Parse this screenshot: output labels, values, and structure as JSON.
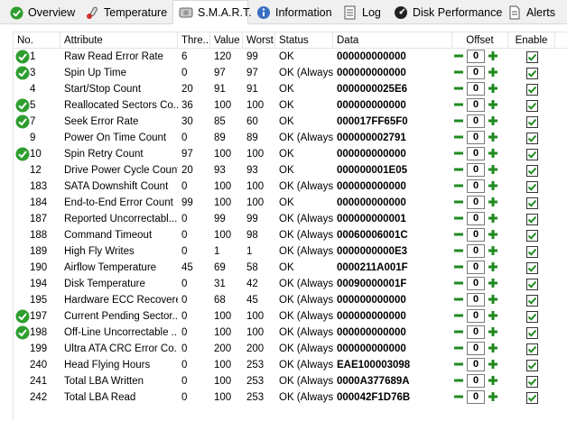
{
  "tabs": [
    {
      "label": "Overview",
      "icon": "check-circle-icon"
    },
    {
      "label": "Temperature",
      "icon": "thermometer-icon"
    },
    {
      "label": "S.M.A.R.T.",
      "icon": "disk-icon"
    },
    {
      "label": "Information",
      "icon": "info-icon"
    },
    {
      "label": "Log",
      "icon": "notepad-icon"
    },
    {
      "label": "Disk Performance",
      "icon": "gauge-icon"
    },
    {
      "label": "Alerts",
      "icon": "document-icon"
    }
  ],
  "active_tab": "S.M.A.R.T.",
  "columns": [
    "No.",
    "Attribute",
    "Thre...",
    "Value",
    "Worst",
    "Status",
    "Data",
    "Offset",
    "Enable"
  ],
  "colors": {
    "ok_green": "#2e9e2e",
    "button_green": "#1f8a1f"
  },
  "rows": [
    {
      "no": "1",
      "attr": "Raw Read Error Rate",
      "thr": "6",
      "val": "120",
      "worst": "99",
      "status": "OK",
      "data": "000000000000",
      "offset": "0",
      "ok": true
    },
    {
      "no": "3",
      "attr": "Spin Up Time",
      "thr": "0",
      "val": "97",
      "worst": "97",
      "status": "OK (Always...",
      "data": "000000000000",
      "offset": "0",
      "ok": true
    },
    {
      "no": "4",
      "attr": "Start/Stop Count",
      "thr": "20",
      "val": "91",
      "worst": "91",
      "status": "OK",
      "data": "0000000025E6",
      "offset": "0",
      "ok": false
    },
    {
      "no": "5",
      "attr": "Reallocated Sectors Co...",
      "thr": "36",
      "val": "100",
      "worst": "100",
      "status": "OK",
      "data": "000000000000",
      "offset": "0",
      "ok": true
    },
    {
      "no": "7",
      "attr": "Seek Error Rate",
      "thr": "30",
      "val": "85",
      "worst": "60",
      "status": "OK",
      "data": "000017FF65F0",
      "offset": "0",
      "ok": true
    },
    {
      "no": "9",
      "attr": "Power On Time Count",
      "thr": "0",
      "val": "89",
      "worst": "89",
      "status": "OK (Always...",
      "data": "000000002791",
      "offset": "0",
      "ok": false
    },
    {
      "no": "10",
      "attr": "Spin Retry Count",
      "thr": "97",
      "val": "100",
      "worst": "100",
      "status": "OK",
      "data": "000000000000",
      "offset": "0",
      "ok": true
    },
    {
      "no": "12",
      "attr": "Drive Power Cycle Count",
      "thr": "20",
      "val": "93",
      "worst": "93",
      "status": "OK",
      "data": "000000001E05",
      "offset": "0",
      "ok": false
    },
    {
      "no": "183",
      "attr": "SATA Downshift Count",
      "thr": "0",
      "val": "100",
      "worst": "100",
      "status": "OK (Always...",
      "data": "000000000000",
      "offset": "0",
      "ok": false
    },
    {
      "no": "184",
      "attr": "End-to-End Error Count",
      "thr": "99",
      "val": "100",
      "worst": "100",
      "status": "OK",
      "data": "000000000000",
      "offset": "0",
      "ok": false
    },
    {
      "no": "187",
      "attr": "Reported Uncorrectabl...",
      "thr": "0",
      "val": "99",
      "worst": "99",
      "status": "OK (Always...",
      "data": "000000000001",
      "offset": "0",
      "ok": false
    },
    {
      "no": "188",
      "attr": "Command Timeout",
      "thr": "0",
      "val": "100",
      "worst": "98",
      "status": "OK (Always...",
      "data": "00060006001C",
      "offset": "0",
      "ok": false
    },
    {
      "no": "189",
      "attr": "High Fly Writes",
      "thr": "0",
      "val": "1",
      "worst": "1",
      "status": "OK (Always...",
      "data": "0000000000E3",
      "offset": "0",
      "ok": false
    },
    {
      "no": "190",
      "attr": "Airflow Temperature",
      "thr": "45",
      "val": "69",
      "worst": "58",
      "status": "OK",
      "data": "0000211A001F",
      "offset": "0",
      "ok": false
    },
    {
      "no": "194",
      "attr": "Disk Temperature",
      "thr": "0",
      "val": "31",
      "worst": "42",
      "status": "OK (Always...",
      "data": "00090000001F",
      "offset": "0",
      "ok": false
    },
    {
      "no": "195",
      "attr": "Hardware ECC Recovered",
      "thr": "0",
      "val": "68",
      "worst": "45",
      "status": "OK (Always...",
      "data": "000000000000",
      "offset": "0",
      "ok": false
    },
    {
      "no": "197",
      "attr": "Current Pending Sector...",
      "thr": "0",
      "val": "100",
      "worst": "100",
      "status": "OK (Always...",
      "data": "000000000000",
      "offset": "0",
      "ok": true
    },
    {
      "no": "198",
      "attr": "Off-Line Uncorrectable ...",
      "thr": "0",
      "val": "100",
      "worst": "100",
      "status": "OK (Always...",
      "data": "000000000000",
      "offset": "0",
      "ok": true
    },
    {
      "no": "199",
      "attr": "Ultra ATA CRC Error Co...",
      "thr": "0",
      "val": "200",
      "worst": "200",
      "status": "OK (Always...",
      "data": "000000000000",
      "offset": "0",
      "ok": false
    },
    {
      "no": "240",
      "attr": "Head Flying Hours",
      "thr": "0",
      "val": "100",
      "worst": "253",
      "status": "OK (Always...",
      "data": "EAE100003098",
      "offset": "0",
      "ok": false
    },
    {
      "no": "241",
      "attr": "Total LBA Written",
      "thr": "0",
      "val": "100",
      "worst": "253",
      "status": "OK (Always...",
      "data": "0000A377689A",
      "offset": "0",
      "ok": false
    },
    {
      "no": "242",
      "attr": "Total LBA Read",
      "thr": "0",
      "val": "100",
      "worst": "253",
      "status": "OK (Always...",
      "data": "000042F1D76B",
      "offset": "0",
      "ok": false
    }
  ]
}
